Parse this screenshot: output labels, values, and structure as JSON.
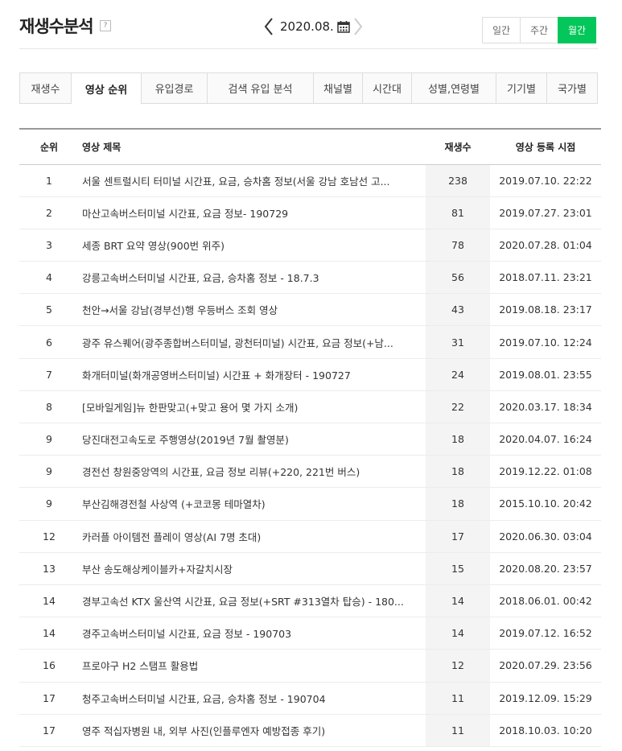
{
  "header": {
    "title": "재생수분석",
    "help": "?",
    "date": "2020.08.",
    "period_tabs": [
      {
        "label": "일간",
        "active": false
      },
      {
        "label": "주간",
        "active": false
      },
      {
        "label": "월간",
        "active": true
      }
    ]
  },
  "tabs": [
    {
      "label": "재생수",
      "active": false
    },
    {
      "label": "영상 순위",
      "active": true
    },
    {
      "label": "유입경로",
      "active": false
    },
    {
      "label": "검색 유입 분석",
      "active": false
    },
    {
      "label": "채널별",
      "active": false
    },
    {
      "label": "시간대",
      "active": false
    },
    {
      "label": "성별,연령별",
      "active": false
    },
    {
      "label": "기기별",
      "active": false
    },
    {
      "label": "국가별",
      "active": false
    }
  ],
  "table": {
    "headers": {
      "rank": "순위",
      "title": "영상 제목",
      "plays": "재생수",
      "date": "영상 등록 시점"
    },
    "rows": [
      {
        "rank": "1",
        "title": "서울 센트럴시티 터미널 시간표, 요금, 승차홈 정보(서울 강남 호남선 고...",
        "plays": "238",
        "date": "2019.07.10. 22:22"
      },
      {
        "rank": "2",
        "title": "마산고속버스터미널 시간표, 요금 정보- 190729",
        "plays": "81",
        "date": "2019.07.27. 23:01"
      },
      {
        "rank": "3",
        "title": "세종 BRT 요약 영상(900번 위주)",
        "plays": "78",
        "date": "2020.07.28. 01:04"
      },
      {
        "rank": "4",
        "title": "강릉고속버스터미널 시간표, 요금, 승차홈 정보 - 18.7.3",
        "plays": "56",
        "date": "2018.07.11. 23:21"
      },
      {
        "rank": "5",
        "title": "천안→서울 강남(경부선)행 우등버스 조회 영상",
        "plays": "43",
        "date": "2019.08.18. 23:17"
      },
      {
        "rank": "6",
        "title": "광주 유스퀘어(광주종합버스터미널, 광천터미널) 시간표, 요금 정보(+남...",
        "plays": "31",
        "date": "2019.07.10. 12:24"
      },
      {
        "rank": "7",
        "title": "화개터미널(화개공영버스터미널) 시간표 + 화개장터 - 190727",
        "plays": "24",
        "date": "2019.08.01. 23:55"
      },
      {
        "rank": "8",
        "title": "[모바일게임]뉴 한판맞고(+맞고 용어 몇 가지 소개)",
        "plays": "22",
        "date": "2020.03.17. 18:34"
      },
      {
        "rank": "9",
        "title": "당진대전고속도로 주행영상(2019년 7월 촬영분)",
        "plays": "18",
        "date": "2020.04.07. 16:24"
      },
      {
        "rank": "9",
        "title": "경전선 창원중앙역의 시간표, 요금 정보 리뷰(+220, 221번 버스)",
        "plays": "18",
        "date": "2019.12.22. 01:08"
      },
      {
        "rank": "9",
        "title": "부산김해경전철 사상역 (+코코몽 테마열차)",
        "plays": "18",
        "date": "2015.10.10. 20:42"
      },
      {
        "rank": "12",
        "title": "카러플 아이템전 플레이 영상(AI 7명 초대)",
        "plays": "17",
        "date": "2020.06.30. 03:04"
      },
      {
        "rank": "13",
        "title": "부산 송도해상케이블카+자갈치시장",
        "plays": "15",
        "date": "2020.08.20. 23:57"
      },
      {
        "rank": "14",
        "title": "경부고속선 KTX 울산역 시간표, 요금 정보(+SRT #313열차 탑승) - 180...",
        "plays": "14",
        "date": "2018.06.01. 00:42"
      },
      {
        "rank": "14",
        "title": "경주고속버스터미널 시간표, 요금 정보 - 190703",
        "plays": "14",
        "date": "2019.07.12. 16:52"
      },
      {
        "rank": "16",
        "title": "프로야구 H2 스탬프 활용법",
        "plays": "12",
        "date": "2020.07.29. 23:56"
      },
      {
        "rank": "17",
        "title": "청주고속버스터미널 시간표, 요금, 승차홈 정보 - 190704",
        "plays": "11",
        "date": "2019.12.09. 15:29"
      },
      {
        "rank": "17",
        "title": "영주 적십자병원 내, 외부 사진(인플루엔자 예방접종 후기)",
        "plays": "11",
        "date": "2018.10.03. 10:20"
      }
    ]
  }
}
